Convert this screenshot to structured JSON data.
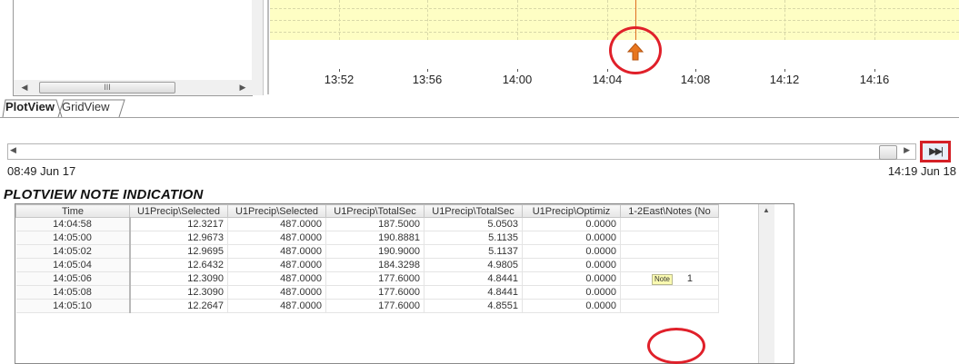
{
  "plot": {
    "scroll_label": "III",
    "x_ticks": [
      "13:52",
      "13:56",
      "14:00",
      "14:04",
      "14:08",
      "14:12",
      "14:16"
    ],
    "cursor_color": "#e07020",
    "note_icon": "up-arrow-icon",
    "callout_color": "#e0202a"
  },
  "tabs": [
    {
      "label": "PlotView",
      "active": true
    },
    {
      "label": "GridView",
      "active": false
    }
  ],
  "timeline": {
    "start": "08:49  Jun 17",
    "end": "14:19  Jun 18",
    "end_button_icon": "skip-to-end-icon",
    "end_button_glyph": "▶▶|"
  },
  "caption": {
    "text": "PLOTVIEW NOTE INDICATION"
  },
  "grid": {
    "columns": [
      "Time",
      "U1Precip\\Selected",
      "U1Precip\\Selected",
      "U1Precip\\TotalSec",
      "U1Precip\\TotalSec",
      "U1Precip\\Optimiz",
      "1-2East\\Notes (No"
    ],
    "rows": [
      [
        "14:04:58",
        "12.3217",
        "487.0000",
        "187.5000",
        "5.0503",
        "0.0000",
        "",
        ""
      ],
      [
        "14:05:00",
        "12.9673",
        "487.0000",
        "190.8881",
        "5.1135",
        "0.0000",
        "",
        ""
      ],
      [
        "14:05:02",
        "12.9695",
        "487.0000",
        "190.9000",
        "5.1137",
        "0.0000",
        "",
        ""
      ],
      [
        "14:05:04",
        "12.6432",
        "487.0000",
        "184.3298",
        "4.9805",
        "0.0000",
        "",
        ""
      ],
      [
        "14:05:06",
        "12.3090",
        "487.0000",
        "177.6000",
        "4.8441",
        "0.0000",
        "Note",
        "1"
      ],
      [
        "14:05:08",
        "12.3090",
        "487.0000",
        "177.6000",
        "4.8441",
        "0.0000",
        "",
        ""
      ],
      [
        "14:05:10",
        "12.2647",
        "487.0000",
        "177.6000",
        "4.8551",
        "0.0000",
        "",
        ""
      ]
    ]
  }
}
